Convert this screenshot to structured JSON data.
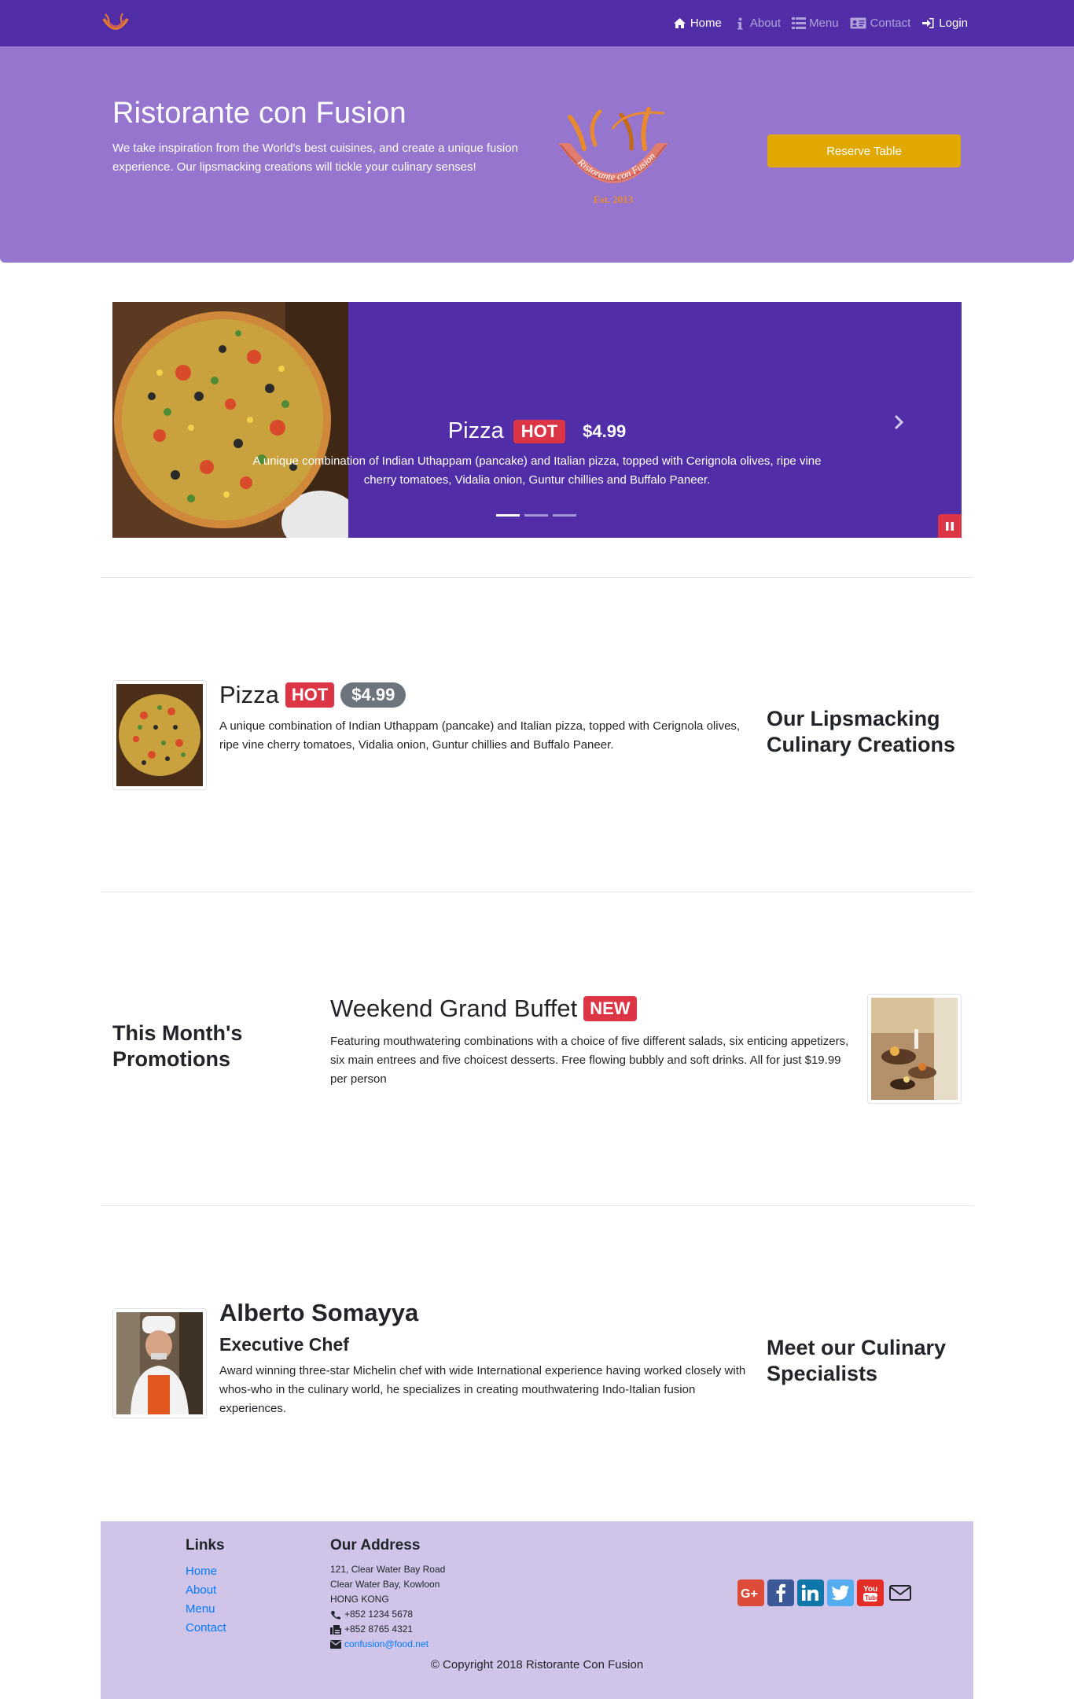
{
  "navbar": {
    "brand_icon": "restaurant-logo-icon",
    "links": [
      {
        "label": "Home",
        "icon": "home-icon"
      },
      {
        "label": "About",
        "icon": "info-icon"
      },
      {
        "label": "Menu",
        "icon": "list-icon"
      },
      {
        "label": "Contact",
        "icon": "address-card-icon"
      }
    ],
    "login": {
      "label": "Login",
      "icon": "sign-in-icon"
    }
  },
  "jumbotron": {
    "title": "Ristorante con Fusion",
    "text": "We take inspiration from the World's best cuisines, and create a unique fusion experience. Our lipsmacking creations will tickle your culinary senses!",
    "logo_text": "Ristorante con Fusion",
    "logo_year": "Est. 2013",
    "reserve_button": "Reserve Table"
  },
  "carousel": {
    "name": "Pizza",
    "badge": "HOT",
    "price": "$4.99",
    "description": "A unique combination of Indian Uthappam (pancake) and Italian pizza, topped with Cerignola olives, ripe vine cherry tomatoes, Vidalia onion, Guntur chillies and Buffalo Paneer.",
    "active_index": 0,
    "slide_count": 3
  },
  "dish": {
    "name": "Pizza",
    "badge": "HOT",
    "price": "$4.99",
    "description": "A unique combination of Indian Uthappam (pancake) and Italian pizza, topped with Cerignola olives, ripe vine cherry tomatoes, Vidalia onion, Guntur chillies and Buffalo Paneer.",
    "heading": "Our Lipsmacking Culinary Creations"
  },
  "promotion": {
    "heading": "This Month's Promotions",
    "name": "Weekend Grand Buffet",
    "badge": "NEW",
    "description": "Featuring mouthwatering combinations with a choice of five different salads, six enticing appetizers, six main entrees and five choicest desserts. Free flowing bubbly and soft drinks. All for just $19.99 per person"
  },
  "leader": {
    "heading": "Meet our Culinary Specialists",
    "name": "Alberto Somayya",
    "designation": "Executive Chef",
    "description": "Award winning three-star Michelin chef with wide International experience having worked closely with whos-who in the culinary world, he specializes in creating mouthwatering Indo-Italian fusion experiences."
  },
  "footer": {
    "links_heading": "Links",
    "links": [
      "Home",
      "About",
      "Menu",
      "Contact"
    ],
    "address_heading": "Our Address",
    "address_lines": [
      "121, Clear Water Bay Road",
      "Clear Water Bay, Kowloon",
      "HONG KONG"
    ],
    "phone": "+852 1234 5678",
    "fax": "+852 8765 4321",
    "email": "confusion@food.net",
    "socials": [
      {
        "icon": "google-plus-icon",
        "color": "#dd4b39"
      },
      {
        "icon": "facebook-icon",
        "color": "#3b5998"
      },
      {
        "icon": "linkedin-icon",
        "color": "#0e76a8"
      },
      {
        "icon": "twitter-icon",
        "color": "#55acee"
      },
      {
        "icon": "youtube-icon",
        "color": "#e52d27"
      },
      {
        "icon": "mail-icon",
        "color": "#212529"
      }
    ],
    "copyright": "© Copyright 2018 Ristorante Con Fusion"
  }
}
